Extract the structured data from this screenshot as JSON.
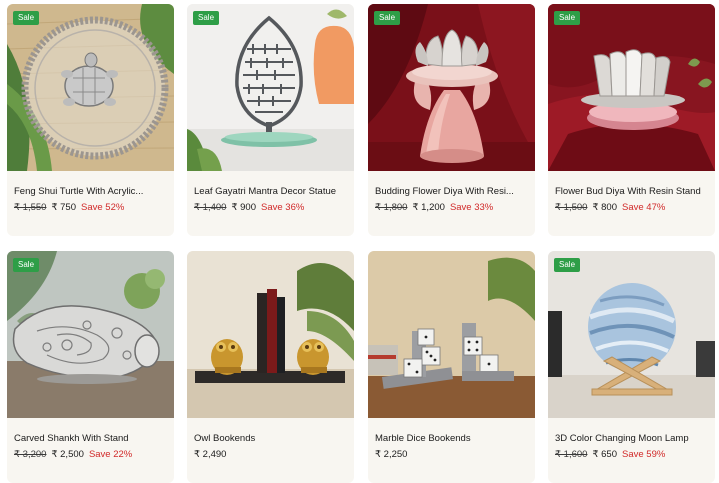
{
  "badge_label": "Sale",
  "products": [
    {
      "name": "Feng Shui Turtle With Acrylic...",
      "old_price": "₹ 1,550",
      "price": "₹ 750",
      "save": "Save 52%",
      "sale": true,
      "image": "turtle-on-acrylic-plate"
    },
    {
      "name": "Leaf Gayatri Mantra Decor Statue",
      "old_price": "₹ 1,400",
      "price": "₹ 900",
      "save": "Save 36%",
      "sale": true,
      "image": "leaf-mantra-statue"
    },
    {
      "name": "Budding Flower Diya With Resi...",
      "old_price": "₹ 1,800",
      "price": "₹ 1,200",
      "save": "Save 33%",
      "sale": true,
      "image": "flower-diya-pink-resin"
    },
    {
      "name": "Flower Bud Diya With Resin Stand",
      "old_price": "₹ 1,500",
      "price": "₹ 800",
      "save": "Save 47%",
      "sale": true,
      "image": "flower-bud-diya"
    },
    {
      "name": "Carved Shankh With Stand",
      "old_price": "₹ 3,200",
      "price": "₹ 2,500",
      "save": "Save 22%",
      "sale": true,
      "image": "silver-conch-shell"
    },
    {
      "name": "Owl Bookends",
      "old_price": "",
      "price": "₹ 2,490",
      "save": "",
      "sale": false,
      "image": "brass-owl-bookends"
    },
    {
      "name": "Marble Dice Bookends",
      "old_price": "",
      "price": "₹ 2,250",
      "save": "",
      "sale": false,
      "image": "marble-dice-bookends"
    },
    {
      "name": "3D Color Changing Moon Lamp",
      "old_price": "₹ 1,600",
      "price": "₹ 650",
      "save": "Save 59%",
      "sale": true,
      "image": "blue-moon-lamp-wood-stand"
    }
  ],
  "colors": {
    "sale_badge": "#2e9e47",
    "save_text": "#d12a2a",
    "card_bg": "#f8f6f1"
  }
}
